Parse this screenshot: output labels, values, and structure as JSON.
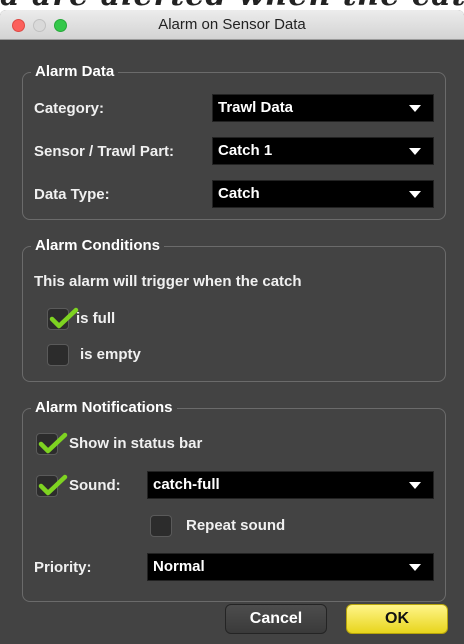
{
  "window": {
    "title": "Alarm on Sensor Data",
    "behind_text": "a are alerted when the catch"
  },
  "alarm_data": {
    "legend": "Alarm Data",
    "category_label": "Category:",
    "category_value": "Trawl Data",
    "sensor_label": "Sensor / Trawl Part:",
    "sensor_value": "Catch 1",
    "data_type_label": "Data Type:",
    "data_type_value": "Catch"
  },
  "alarm_conditions": {
    "legend": "Alarm Conditions",
    "description": "This alarm will trigger when the catch",
    "options": [
      {
        "label": "is full",
        "checked": true
      },
      {
        "label": "is empty",
        "checked": false
      }
    ]
  },
  "alarm_notifications": {
    "legend": "Alarm Notifications",
    "status_bar_label": "Show in status bar",
    "status_bar_checked": true,
    "sound_label": "Sound:",
    "sound_checked": true,
    "sound_value": "catch-full",
    "repeat_label": "Repeat sound",
    "repeat_checked": false,
    "priority_label": "Priority:",
    "priority_value": "Normal"
  },
  "buttons": {
    "cancel": "Cancel",
    "ok": "OK"
  },
  "colors": {
    "panel": "#434343",
    "check": "#7ed321",
    "ok_button": "#f2e23a"
  }
}
